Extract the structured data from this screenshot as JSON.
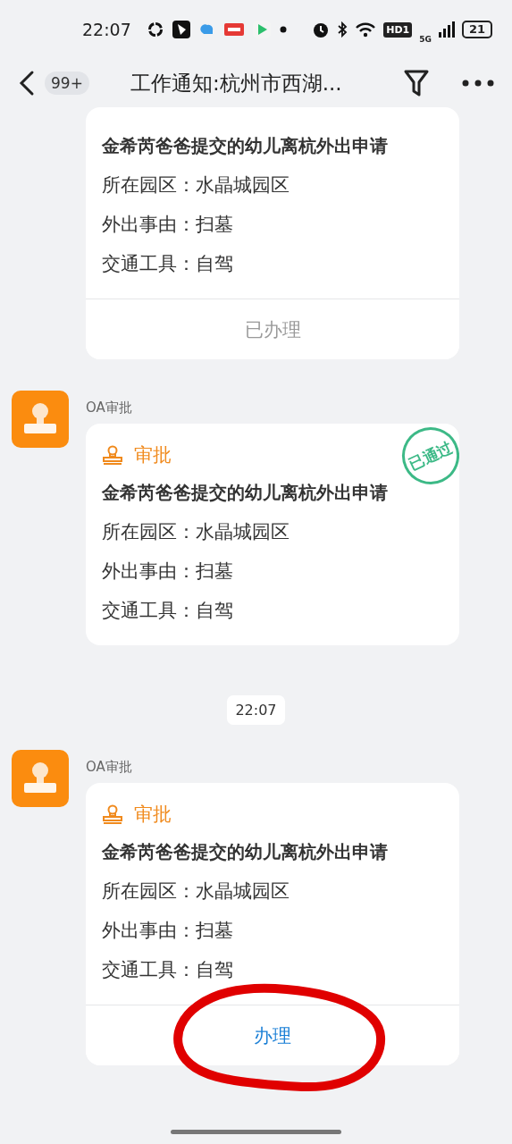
{
  "status_bar": {
    "time": "22:07",
    "hd_label": "HD1",
    "network": "5G",
    "battery": "21"
  },
  "header": {
    "back_badge": "99+",
    "title": "工作通知:杭州市西湖..."
  },
  "messages": [
    {
      "title": "金希芮爸爸提交的幼儿离杭外出申请",
      "fields": [
        {
          "label": "所在园区：",
          "value": "水晶城园区"
        },
        {
          "label": "外出事由：",
          "value": "扫墓"
        },
        {
          "label": "交通工具：",
          "value": "自驾"
        }
      ],
      "action": {
        "label": "已办理",
        "disabled": true,
        "circled": false
      }
    },
    {
      "sender": "OA审批",
      "category": "审批",
      "title": "金希芮爸爸提交的幼儿离杭外出申请",
      "fields": [
        {
          "label": "所在园区：",
          "value": "水晶城园区"
        },
        {
          "label": "外出事由：",
          "value": "扫墓"
        },
        {
          "label": "交通工具：",
          "value": "自驾"
        }
      ],
      "stamp": "已通过",
      "time_after": "22:07"
    },
    {
      "sender": "OA审批",
      "category": "审批",
      "title": "金希芮爸爸提交的幼儿离杭外出申请",
      "fields": [
        {
          "label": "所在园区：",
          "value": "水晶城园区"
        },
        {
          "label": "外出事由：",
          "value": "扫墓"
        },
        {
          "label": "交通工具：",
          "value": "自驾"
        }
      ],
      "action": {
        "label": "办理",
        "disabled": false,
        "circled": true
      }
    }
  ]
}
